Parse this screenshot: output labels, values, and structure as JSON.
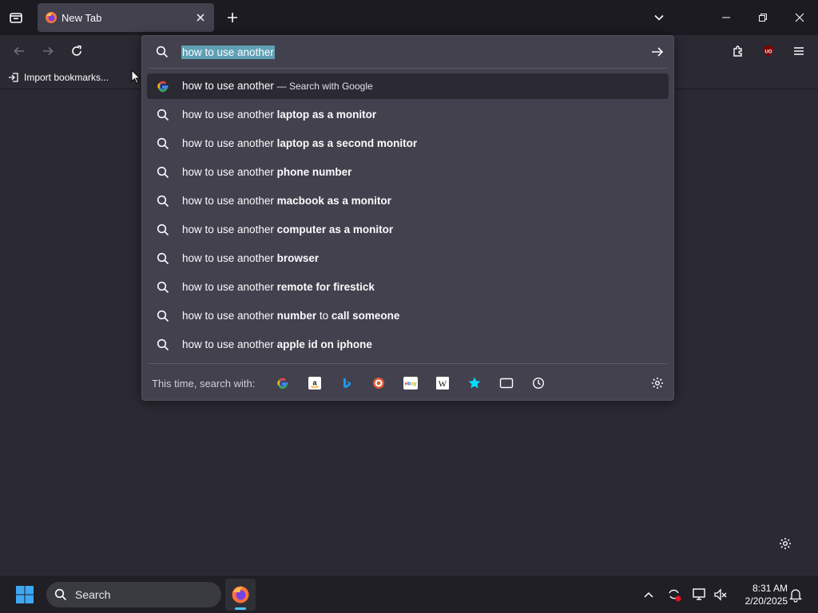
{
  "tabbar": {
    "tab_title": "New Tab"
  },
  "bookmarks": {
    "import_label": "Import bookmarks..."
  },
  "urlbar": {
    "value": "how to use another",
    "rows": [
      {
        "prefix": "how to use another",
        "bold": "",
        "suffix": "",
        "extra": "— Search with Google",
        "icon": "google-icon"
      },
      {
        "prefix": "how to use another ",
        "bold": "laptop as a monitor",
        "suffix": "",
        "extra": "",
        "icon": "search-icon"
      },
      {
        "prefix": "how to use another ",
        "bold": "laptop as a second monitor",
        "suffix": "",
        "extra": "",
        "icon": "search-icon"
      },
      {
        "prefix": "how to use another ",
        "bold": "phone number",
        "suffix": "",
        "extra": "",
        "icon": "search-icon"
      },
      {
        "prefix": "how to use another ",
        "bold": "macbook as a monitor",
        "suffix": "",
        "extra": "",
        "icon": "search-icon"
      },
      {
        "prefix": "how to use another ",
        "bold": "computer as a monitor",
        "suffix": "",
        "extra": "",
        "icon": "search-icon"
      },
      {
        "prefix": "how to use another ",
        "bold": "browser",
        "suffix": "",
        "extra": "",
        "icon": "search-icon"
      },
      {
        "prefix": "how to use another ",
        "bold": "remote for firestick",
        "suffix": "",
        "extra": "",
        "icon": "search-icon"
      },
      {
        "prefix": "how to use another ",
        "bold": "number",
        "suffix": " to ",
        "bold2": "call someone",
        "extra": "",
        "icon": "search-icon"
      },
      {
        "prefix": "how to use another ",
        "bold": "apple id on iphone",
        "suffix": "",
        "extra": "",
        "icon": "search-icon"
      }
    ],
    "search_with_label": "This time, search with:",
    "engines": [
      "google-icon",
      "amazon-icon",
      "bing-icon",
      "duckduckgo-icon",
      "ebay-icon",
      "wikipedia-icon",
      "bookmarks-star-icon",
      "tabs-icon",
      "history-icon"
    ]
  },
  "taskbar": {
    "search_label": "Search",
    "time": "8:31 AM",
    "date": "2/20/2025"
  },
  "colors": {
    "accent": "#00ddff",
    "highlight": "#5fa0b4",
    "panel": "#42414d",
    "background": "#2b2a33"
  }
}
